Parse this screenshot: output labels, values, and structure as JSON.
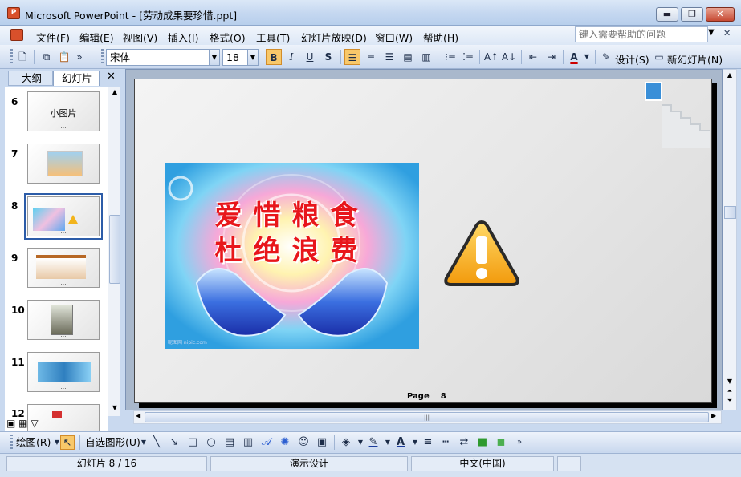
{
  "window": {
    "title": "Microsoft PowerPoint - [劳动成果要珍惜.ppt]",
    "min_glyph": "▬",
    "restore_glyph": "❐",
    "close_glyph": "✕"
  },
  "menu": {
    "items": [
      "文件(F)",
      "编辑(E)",
      "视图(V)",
      "插入(I)",
      "格式(O)",
      "工具(T)",
      "幻灯片放映(D)",
      "窗口(W)",
      "帮助(H)"
    ],
    "help_placeholder": "键入需要帮助的问题"
  },
  "toolbar": {
    "font": "宋体",
    "size": "18",
    "bold": "B",
    "italic": "I",
    "underline": "U",
    "shadow": "S",
    "design_label": "设计(S)",
    "new_slide_label": "新幻灯片(N)"
  },
  "leftpane": {
    "tab_outline": "大纲",
    "tab_slides": "幻灯片",
    "close_glyph": "✕",
    "thumbs": [
      {
        "num": "6",
        "caption": "小图片"
      },
      {
        "num": "7",
        "caption": ""
      },
      {
        "num": "8",
        "caption": ""
      },
      {
        "num": "9",
        "caption": ""
      },
      {
        "num": "10",
        "caption": ""
      },
      {
        "num": "11",
        "caption": ""
      },
      {
        "num": "12",
        "caption": ""
      }
    ]
  },
  "slide": {
    "line1": "爱惜粮食",
    "line2": "杜绝浪费",
    "page_label": "Page",
    "page_number": "8",
    "watermark": "昵图网 nipic.com"
  },
  "drawbar": {
    "draw_label": "绘图(R)",
    "autoshape_label": "自选图形(U)"
  },
  "status": {
    "slide_info": "幻灯片 8 / 16",
    "design": "演示设计",
    "language": "中文(中国)"
  }
}
